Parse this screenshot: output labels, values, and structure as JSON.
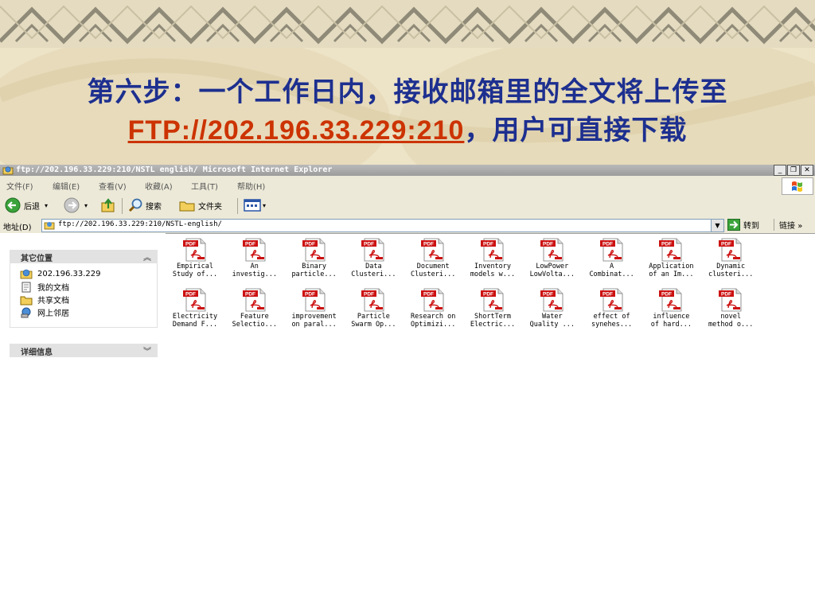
{
  "slide": {
    "title_line1": "第六步：一个工作日内，接收邮箱里的全文将上传至",
    "title_ftp": "FTP://202.196.33.229:210",
    "title_line2_rest": "，用户可直接下载"
  },
  "window": {
    "title": "ftp://202.196.33.229:210/NSTL english/   Microsoft Internet Explorer",
    "buttons": {
      "minimize": "_",
      "restore": "❐",
      "close": "✕"
    }
  },
  "menubar": {
    "items": [
      "文件(F)",
      "编辑(E)",
      "查看(V)",
      "收藏(A)",
      "工具(T)",
      "帮助(H)"
    ]
  },
  "toolbar": {
    "back": "后退",
    "search": "搜索",
    "folders": "文件夹"
  },
  "address": {
    "label": "地址(D)",
    "value": "ftp://202.196.33.229:210/NSTL-english/",
    "go": "转到",
    "links": "链接"
  },
  "task_pane": {
    "other_places_title": "其它位置",
    "other_places": [
      {
        "label": "202.196.33.229",
        "icon": "ftp-globe-icon"
      },
      {
        "label": "我的文档",
        "icon": "my-documents-icon"
      },
      {
        "label": "共享文档",
        "icon": "shared-folder-icon"
      },
      {
        "label": "网上邻居",
        "icon": "network-icon"
      }
    ],
    "details_title": "详细信息"
  },
  "files": [
    {
      "line1": "Empirical",
      "line2": "Study of..."
    },
    {
      "line1": "An",
      "line2": "investig..."
    },
    {
      "line1": "Binary",
      "line2": "particle..."
    },
    {
      "line1": "Data",
      "line2": "Clusteri..."
    },
    {
      "line1": "Document",
      "line2": "Clusteri..."
    },
    {
      "line1": "Inventory",
      "line2": "models w..."
    },
    {
      "line1": "LowPower",
      "line2": "LowVolta..."
    },
    {
      "line1": "A",
      "line2": "Combinat..."
    },
    {
      "line1": "Application",
      "line2": "of an Im..."
    },
    {
      "line1": "Dynamic",
      "line2": "clusteri..."
    },
    {
      "line1": "Electricity",
      "line2": "Demand F..."
    },
    {
      "line1": "Feature",
      "line2": "Selectio..."
    },
    {
      "line1": "improvement",
      "line2": "on paral..."
    },
    {
      "line1": "Particle",
      "line2": "Swarm Op..."
    },
    {
      "line1": "Research on",
      "line2": "Optimizi..."
    },
    {
      "line1": "ShortTerm",
      "line2": "Electric..."
    },
    {
      "line1": "Water",
      "line2": "Quality ..."
    },
    {
      "line1": "effect of",
      "line2": "synehes..."
    },
    {
      "line1": "influence",
      "line2": "of hard..."
    },
    {
      "line1": "novel",
      "line2": "method o..."
    }
  ],
  "pdf_badge": "PDF",
  "colors": {
    "title_blue": "#1d2f8f",
    "ftp_link": "#cc3300",
    "pdf_red": "#cc1111"
  }
}
